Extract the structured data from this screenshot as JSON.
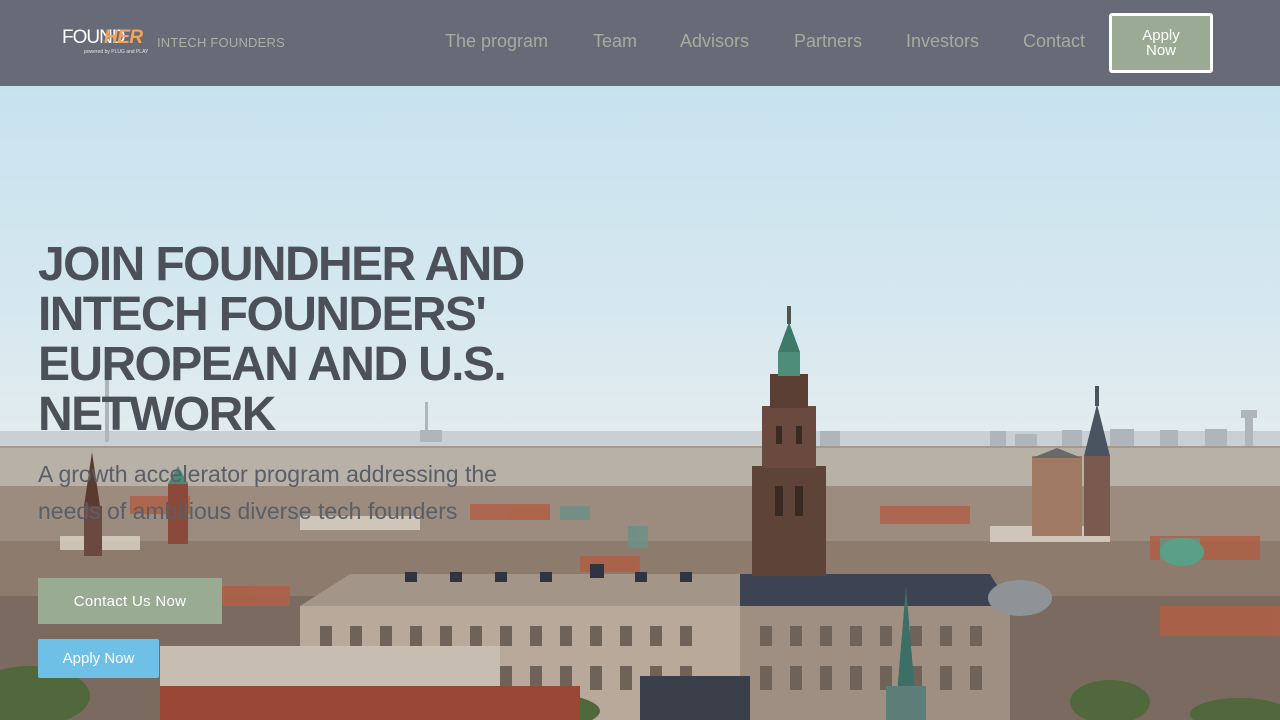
{
  "brand": {
    "logo_found": "FOUND",
    "logo_her": "HER",
    "logo_sub": "powered by PLUG and PLAY",
    "partner_text": "INTECH FOUNDERS"
  },
  "nav": {
    "items": [
      {
        "label": "The program"
      },
      {
        "label": "Team"
      },
      {
        "label": "Advisors"
      },
      {
        "label": "Partners"
      },
      {
        "label": "Investors"
      },
      {
        "label": "Contact"
      }
    ],
    "apply_label": "Apply Now"
  },
  "hero": {
    "title": "JOIN FOUNDHER AND INTECH FOUNDERS' EUROPEAN AND U.S. NETWORK",
    "subtitle": "A growth accelerator program addressing the needs of ambitious diverse tech founders",
    "contact_button": "Contact Us Now",
    "apply_button": "Apply Now"
  },
  "colors": {
    "header_bg": "#676a77",
    "nav_text": "#a3ae9f",
    "accent_green": "#9aab94",
    "accent_blue": "#6ec0e6",
    "logo_orange": "#f4a259"
  }
}
